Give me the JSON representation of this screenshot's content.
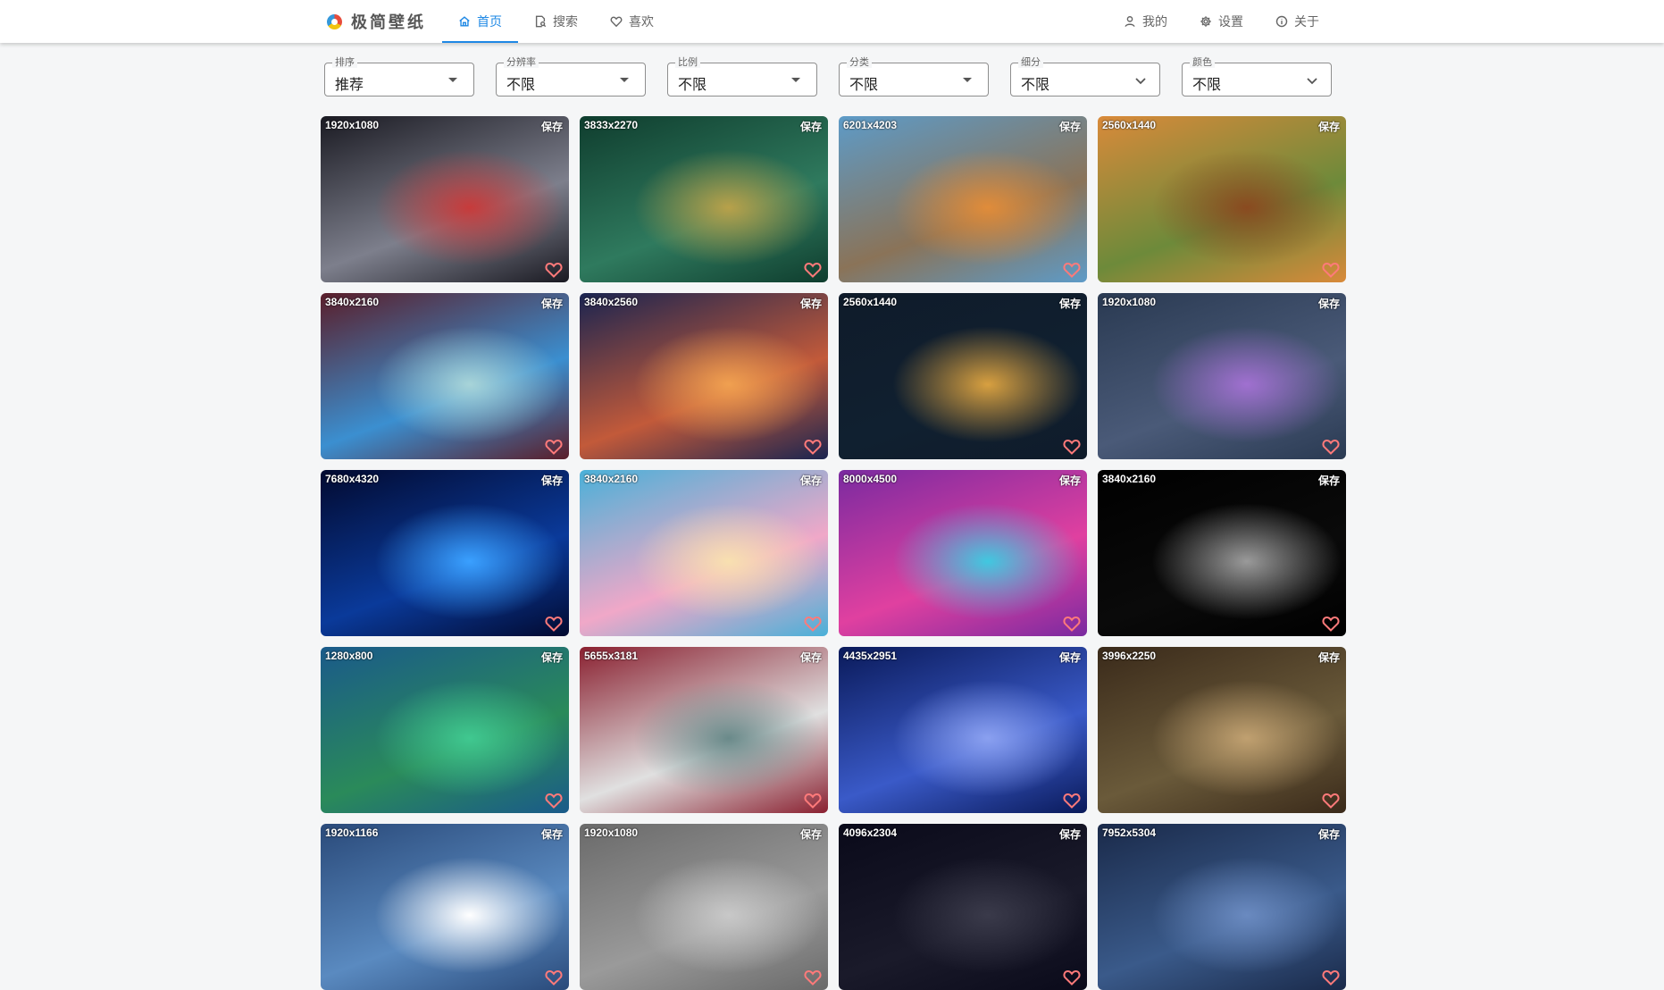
{
  "header": {
    "logo_text": "极简壁纸",
    "nav_left": [
      {
        "label": "首页",
        "icon": "home-icon",
        "active": true
      },
      {
        "label": "搜索",
        "icon": "search-file-icon",
        "active": false
      },
      {
        "label": "喜欢",
        "icon": "heart-icon",
        "active": false
      }
    ],
    "nav_right": [
      {
        "label": "我的",
        "icon": "user-icon"
      },
      {
        "label": "设置",
        "icon": "gear-icon"
      },
      {
        "label": "关于",
        "icon": "info-icon"
      }
    ]
  },
  "filters": [
    {
      "label": "排序",
      "value": "推荐"
    },
    {
      "label": "分辨率",
      "value": "不限"
    },
    {
      "label": "比例",
      "value": "不限"
    },
    {
      "label": "分类",
      "value": "不限"
    },
    {
      "label": "细分",
      "value": "不限"
    },
    {
      "label": "颜色",
      "value": "不限"
    }
  ],
  "wallpapers": [
    {
      "resolution": "1920x1080",
      "save": "保存",
      "colors": [
        "#1a1a22",
        "#7d7f8c",
        "#c73b3b"
      ]
    },
    {
      "resolution": "3833x2270",
      "save": "保存",
      "colors": [
        "#0f3d2e",
        "#2f7a5e",
        "#b8a14a"
      ]
    },
    {
      "resolution": "6201x4203",
      "save": "保存",
      "colors": [
        "#5d9bc8",
        "#8a7358",
        "#e08c3a"
      ]
    },
    {
      "resolution": "2560x1440",
      "save": "保存",
      "colors": [
        "#d98a3a",
        "#6d8a3a",
        "#8a4a20"
      ]
    },
    {
      "resolution": "3840x2160",
      "save": "保存",
      "colors": [
        "#5a1e2a",
        "#3b8fd0",
        "#a8d4d8"
      ]
    },
    {
      "resolution": "3840x2560",
      "save": "保存",
      "colors": [
        "#1a2450",
        "#c25a3a",
        "#f0a050"
      ]
    },
    {
      "resolution": "2560x1440",
      "save": "保存",
      "colors": [
        "#0f1b2a",
        "#102030",
        "#d8a040"
      ]
    },
    {
      "resolution": "1920x1080",
      "save": "保存",
      "colors": [
        "#2a3a52",
        "#4a5a78",
        "#a070d0"
      ]
    },
    {
      "resolution": "7680x4320",
      "save": "保存",
      "colors": [
        "#020a30",
        "#0a3a9a",
        "#3aa0ff"
      ]
    },
    {
      "resolution": "3840x2160",
      "save": "保存",
      "colors": [
        "#4ab0d8",
        "#f0a8c8",
        "#f8e0b0"
      ]
    },
    {
      "resolution": "8000x4500",
      "save": "保存",
      "colors": [
        "#7a2aa0",
        "#e040a0",
        "#40c8e0"
      ]
    },
    {
      "resolution": "3840x2160",
      "save": "保存",
      "colors": [
        "#000000",
        "#0a0a0a",
        "#9a9a9a"
      ]
    },
    {
      "resolution": "1280x800",
      "save": "保存",
      "colors": [
        "#1a5a8a",
        "#2a8a5a",
        "#40c890"
      ]
    },
    {
      "resolution": "5655x3181",
      "save": "保存",
      "colors": [
        "#8a2030",
        "#e0e0e0",
        "#6a8a8a"
      ]
    },
    {
      "resolution": "4435x2951",
      "save": "保存",
      "colors": [
        "#0a1a5a",
        "#3a5ac8",
        "#8aa0f0"
      ]
    },
    {
      "resolution": "3996x2250",
      "save": "保存",
      "colors": [
        "#3a2a1a",
        "#6a5a3a",
        "#c0a070"
      ]
    },
    {
      "resolution": "1920x1166",
      "save": "保存",
      "colors": [
        "#2a4a7a",
        "#5a8ac0",
        "#ffffff"
      ]
    },
    {
      "resolution": "1920x1080",
      "save": "保存",
      "colors": [
        "#6a6a6a",
        "#9a9a9a",
        "#c8c8c8"
      ]
    },
    {
      "resolution": "4096x2304",
      "save": "保存",
      "colors": [
        "#0a0a1a",
        "#1a1a2a",
        "#3a3a4a"
      ]
    },
    {
      "resolution": "7952x5304",
      "save": "保存",
      "colors": [
        "#1a2a4a",
        "#3a5a8a",
        "#6a8ac0"
      ]
    }
  ]
}
